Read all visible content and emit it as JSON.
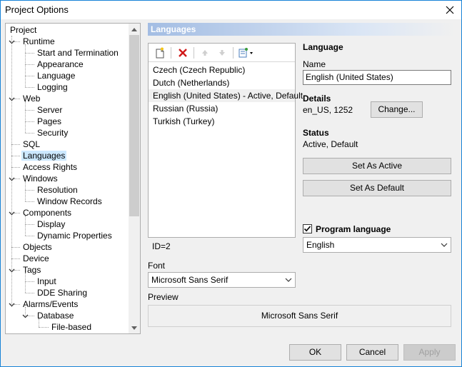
{
  "window": {
    "title": "Project Options"
  },
  "tree": {
    "items": [
      {
        "label": "Project",
        "level": 0,
        "expander": "none"
      },
      {
        "label": "Runtime",
        "level": 1,
        "expander": "expanded"
      },
      {
        "label": "Start and Termination",
        "level": 2,
        "expander": "none"
      },
      {
        "label": "Appearance",
        "level": 2,
        "expander": "none"
      },
      {
        "label": "Language",
        "level": 2,
        "expander": "none"
      },
      {
        "label": "Logging",
        "level": 2,
        "expander": "none"
      },
      {
        "label": "Web",
        "level": 1,
        "expander": "expanded"
      },
      {
        "label": "Server",
        "level": 2,
        "expander": "none"
      },
      {
        "label": "Pages",
        "level": 2,
        "expander": "none"
      },
      {
        "label": "Security",
        "level": 2,
        "expander": "none"
      },
      {
        "label": "SQL",
        "level": 1,
        "expander": "none"
      },
      {
        "label": "Languages",
        "level": 1,
        "expander": "none",
        "selected": true
      },
      {
        "label": "Access Rights",
        "level": 1,
        "expander": "none"
      },
      {
        "label": "Windows",
        "level": 1,
        "expander": "expanded"
      },
      {
        "label": "Resolution",
        "level": 2,
        "expander": "none"
      },
      {
        "label": "Window Records",
        "level": 2,
        "expander": "none"
      },
      {
        "label": "Components",
        "level": 1,
        "expander": "expanded"
      },
      {
        "label": "Display",
        "level": 2,
        "expander": "none"
      },
      {
        "label": "Dynamic Properties",
        "level": 2,
        "expander": "none"
      },
      {
        "label": "Objects",
        "level": 1,
        "expander": "none"
      },
      {
        "label": "Device",
        "level": 1,
        "expander": "none"
      },
      {
        "label": "Tags",
        "level": 1,
        "expander": "expanded"
      },
      {
        "label": "Input",
        "level": 2,
        "expander": "none"
      },
      {
        "label": "DDE Sharing",
        "level": 2,
        "expander": "none"
      },
      {
        "label": "Alarms/Events",
        "level": 1,
        "expander": "expanded"
      },
      {
        "label": "Database",
        "level": 2,
        "expander": "expanded"
      },
      {
        "label": "File-based",
        "level": 3,
        "expander": "none"
      }
    ]
  },
  "section": {
    "title": "Languages"
  },
  "languages": {
    "items": [
      {
        "label": "Czech (Czech Republic)",
        "active": false
      },
      {
        "label": "Dutch (Netherlands)",
        "active": false
      },
      {
        "label": "English (United States) - Active, Default",
        "active": true
      },
      {
        "label": "Russian (Russia)",
        "active": false
      },
      {
        "label": "Turkish (Turkey)",
        "active": false
      }
    ],
    "id_text": "ID=2"
  },
  "font": {
    "label": "Font",
    "value": "Microsoft Sans Serif"
  },
  "preview": {
    "label": "Preview",
    "text": "Microsoft Sans Serif"
  },
  "language_panel": {
    "header": "Language",
    "name_label": "Name",
    "name_value": "English (United States)",
    "details_header": "Details",
    "details_value": "en_US, 1252",
    "change_button": "Change...",
    "status_header": "Status",
    "status_value": "Active, Default",
    "set_active_button": "Set As Active",
    "set_default_button": "Set As Default",
    "program_language_label": "Program language",
    "program_language_checked": true,
    "program_language_value": "English"
  },
  "footer": {
    "ok": "OK",
    "cancel": "Cancel",
    "apply": "Apply"
  },
  "colors": {
    "selection": "#cce8ff",
    "header_gradient_start": "#a3bde3",
    "delete_red": "#d11a1a"
  }
}
